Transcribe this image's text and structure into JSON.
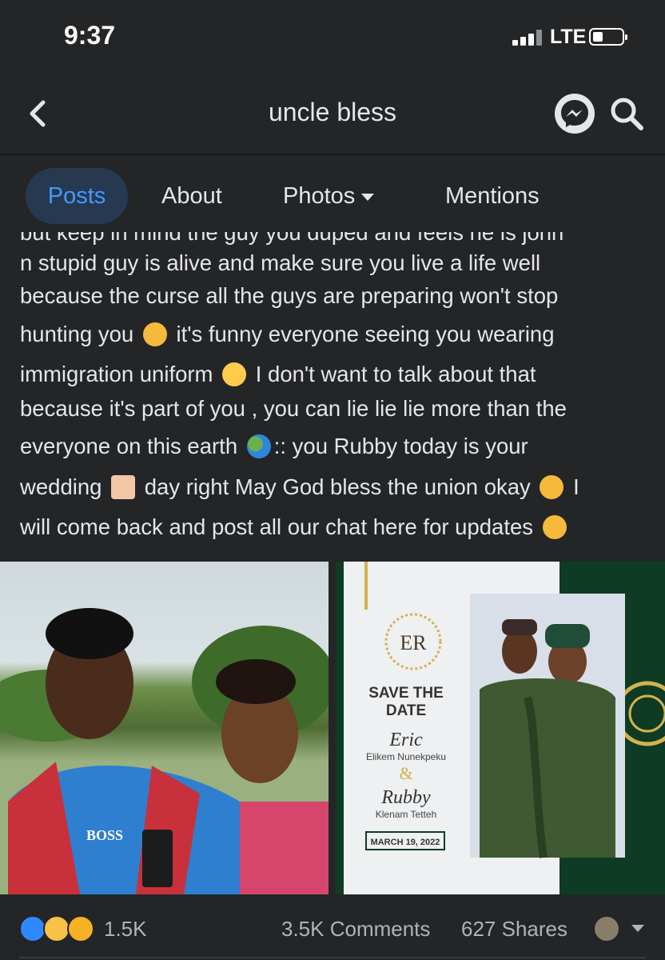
{
  "status_bar": {
    "time": "9:37",
    "network": "LTE"
  },
  "header": {
    "title": "uncle bless"
  },
  "tabs": [
    {
      "label": "Posts"
    },
    {
      "label": "About"
    },
    {
      "label": "Photos"
    },
    {
      "label": "Mentions"
    }
  ],
  "post": {
    "cut_line": "but keep in mind the guy you duped and feels he is john",
    "lines": [
      "n stupid guy is alive and make sure you live a life well",
      "because the curse all the guys are preparing won't stop",
      "hunting you",
      "it's funny everyone seeing you wearing",
      "immigration uniform",
      "I don't want to talk about that",
      "because it's part of you , you can lie lie lie more than the",
      "everyone on this earth",
      ":: you Rubby today is your",
      "wedding",
      "day right May God bless the union okay",
      "I",
      "will come back and post all our chat here for updates"
    ]
  },
  "invite": {
    "monogram": "ER",
    "heading_1": "SAVE THE",
    "heading_2": "DATE",
    "groom_first": "Eric",
    "groom_full": "Elikem Nunekpeku",
    "ampersand": "&",
    "bride_first": "Rubby",
    "bride_full": "Klenam Tetteh",
    "date": "MARCH 19, 2022"
  },
  "photo_left": {
    "shirt_text": "BOSS"
  },
  "engagement": {
    "reaction_count": "1.5K",
    "comments": "3.5K Comments",
    "shares": "627 Shares"
  },
  "colors": {
    "background": "#242526",
    "accent": "#4599ff",
    "active_tab_bg": "#263951",
    "text": "#e4e6eb",
    "muted": "#b0b3b8"
  }
}
